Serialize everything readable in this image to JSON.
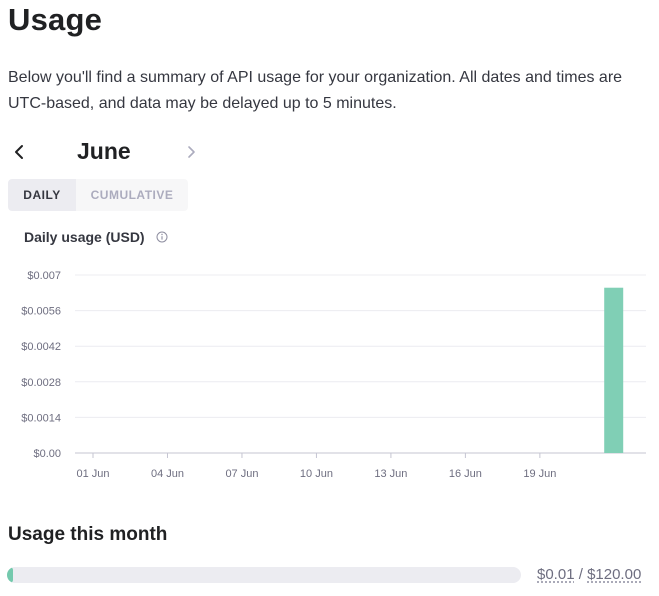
{
  "page": {
    "title": "Usage",
    "description": "Below you'll find a summary of API usage for your organization. All dates and times are UTC-based, and data may be delayed up to 5 minutes."
  },
  "month_nav": {
    "month": "June",
    "prev_icon": "chevron-left-icon",
    "next_icon": "chevron-right-icon"
  },
  "toggle": {
    "daily_label": "DAILY",
    "cumulative_label": "CUMULATIVE",
    "selected": "DAILY"
  },
  "chart_title": "Daily usage (USD)",
  "chart_data": {
    "type": "bar",
    "title": "Daily usage (USD)",
    "xlabel": "",
    "ylabel": "",
    "ylim": [
      0,
      0.007
    ],
    "y_ticks": [
      "$0.00",
      "$0.0014",
      "$0.0028",
      "$0.0042",
      "$0.0056",
      "$0.007"
    ],
    "x_ticks": [
      "01 Jun",
      "04 Jun",
      "07 Jun",
      "10 Jun",
      "13 Jun",
      "16 Jun",
      "19 Jun"
    ],
    "categories": [
      "01 Jun",
      "02 Jun",
      "03 Jun",
      "04 Jun",
      "05 Jun",
      "06 Jun",
      "07 Jun",
      "08 Jun",
      "09 Jun",
      "10 Jun",
      "11 Jun",
      "12 Jun",
      "13 Jun",
      "14 Jun",
      "15 Jun",
      "16 Jun",
      "17 Jun",
      "18 Jun",
      "19 Jun",
      "20 Jun",
      "21 Jun"
    ],
    "values": [
      0,
      0,
      0,
      0,
      0,
      0,
      0,
      0,
      0,
      0,
      0,
      0,
      0,
      0,
      0,
      0,
      0,
      0,
      0,
      0,
      0.0065
    ],
    "bar_color": "#80cfb5",
    "grid": true
  },
  "usage_month": {
    "title": "Usage this month",
    "used": "$0.01",
    "separator": "/",
    "limit": "$120.00",
    "progress_fraction": 0.0001,
    "fill_color": "#74c9ad"
  }
}
